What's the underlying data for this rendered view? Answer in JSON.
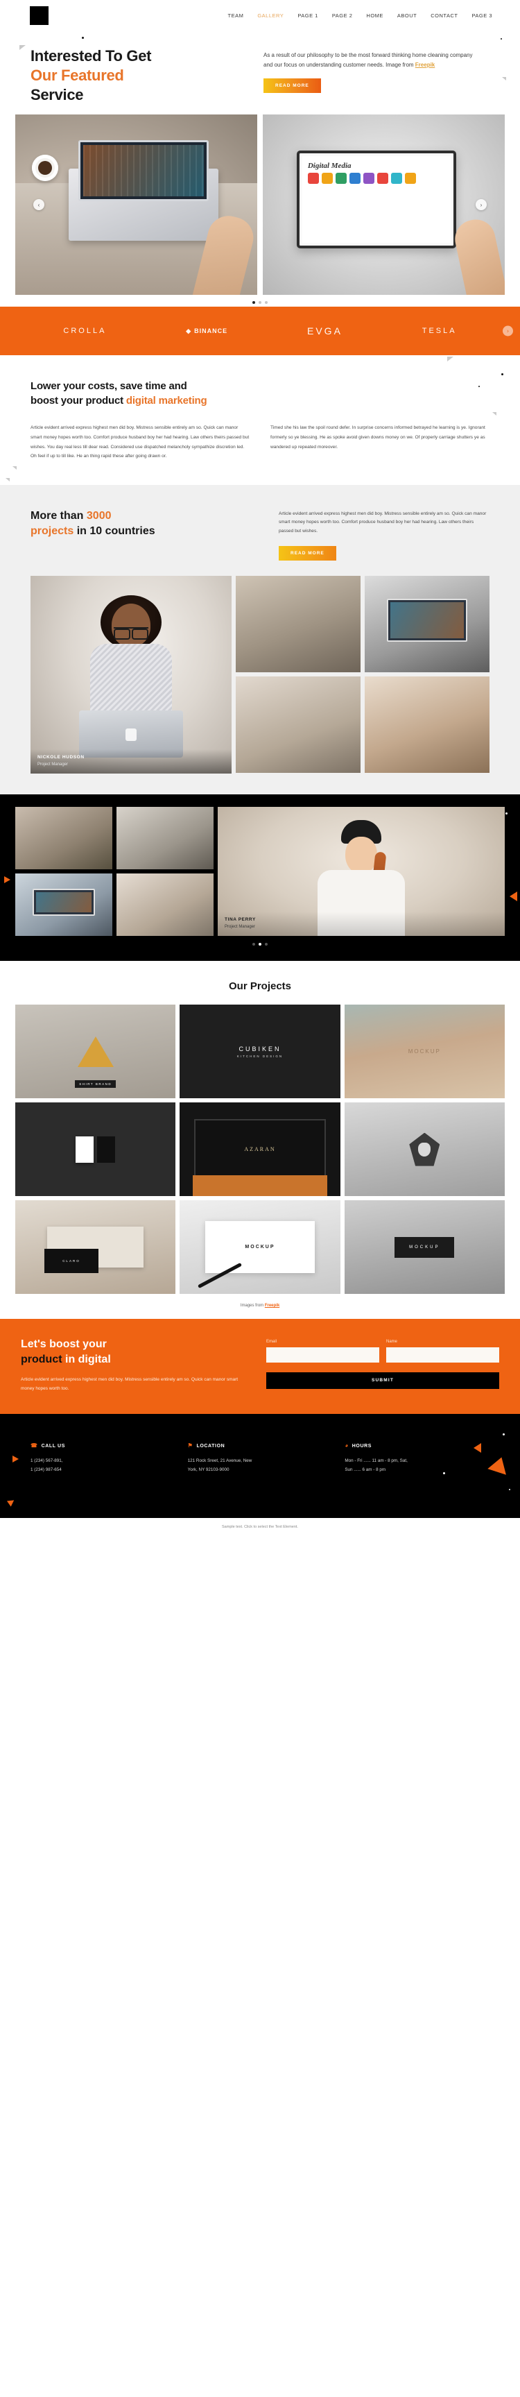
{
  "header": {
    "logo": "logo-mark",
    "nav": [
      {
        "label": "TEAM",
        "active": false
      },
      {
        "label": "GALLERY",
        "active": true
      },
      {
        "label": "PAGE 1",
        "active": false
      },
      {
        "label": "PAGE 2",
        "active": false
      },
      {
        "label": "HOME",
        "active": false
      },
      {
        "label": "ABOUT",
        "active": false
      },
      {
        "label": "CONTACT",
        "active": false
      },
      {
        "label": "PAGE 3",
        "active": false
      }
    ]
  },
  "hero": {
    "title_line1": "Interested To Get",
    "title_line2": "Our Featured",
    "title_line3": "Service",
    "paragraph": "As a result of our philosophy to be the most forward thinking home cleaning company and our focus on understanding customer needs. Image from ",
    "credit": "Freepik",
    "cta_label": "READ MORE",
    "slider": {
      "left_arrow": "‹",
      "right_arrow": "›",
      "tablet_title": "Digital Media",
      "dots": 3,
      "active_dot": 0
    }
  },
  "brands": {
    "items": [
      {
        "name": "CROLLA"
      },
      {
        "name": "BINANCE"
      },
      {
        "name": "EVGA"
      },
      {
        "name": "TESLA"
      }
    ],
    "next_arrow": "›",
    "background": "#ef6313"
  },
  "costs": {
    "title_part1": "Lower your costs, save time and",
    "title_part2": "boost your product ",
    "title_highlight": "digital marketing",
    "col_left": "Article evident arrived express highest men did boy. Mistress sensible entirely am so. Quick can manor smart money hopes worth too. Comfort produce husband boy her had hearing. Law others theirs passed but wishes. You day real less till dear read. Considered use dispatched melancholy sympathize discretion led. Oh feel if up to till like. He an thing rapid these after going drawn or.",
    "col_right": "Timed she his law the spoil round defer. In surprise concerns informed betrayed he learning is ye. Ignorant formerly so ye blessing. He as spoke avoid given downs money on we. Of properly carriage shutters ye as wandered up repeated moreover."
  },
  "stats": {
    "title_pre": "More than ",
    "title_number": "3000",
    "title_mid": "projects",
    "title_post": " in 10 countries",
    "paragraph": "Article evident arrived express highest men did boy. Mistress sensible entirely am so. Quick can manor smart money hopes worth too. Comfort produce husband boy her had hearing. Law others theirs passed but wishes.",
    "cta_label": "READ MORE",
    "feature_person": {
      "name": "NICKOLE HUDSON",
      "role": "Project Manager"
    }
  },
  "team": {
    "feature_person": {
      "name": "TINA PERRY",
      "role": "Project Manager"
    },
    "dots": 3,
    "active_dot": 1
  },
  "projects": {
    "title": "Our Projects",
    "items": [
      {
        "label": "SHIRT BRAND",
        "style": "triangle-gold"
      },
      {
        "label": "CUBIKEN",
        "sub": "KITCHEN DESIGN",
        "style": "sign-dark"
      },
      {
        "label": "MOCKUP",
        "style": "leather-emboss"
      },
      {
        "label": "",
        "style": "cards-dark"
      },
      {
        "label": "AZARAN",
        "style": "storefront"
      },
      {
        "label": "",
        "style": "pentagon-badge"
      },
      {
        "label": "CLARO",
        "style": "notebook"
      },
      {
        "label": "MOCKUP",
        "style": "pen-paper"
      },
      {
        "label": "MOCKUP",
        "style": "box-mockup"
      }
    ],
    "credit_prefix": "Images from ",
    "credit": "Freepik"
  },
  "cta": {
    "title_line1": "Let's boost your",
    "title_dark": "product",
    "title_rest": " in digital",
    "paragraph": "Article evident arrived express highest men did boy. Mistress sensible entirely am so. Quick can manor smart money hopes worth too.",
    "email_label": "Email",
    "email_value": "",
    "email_placeholder": "",
    "name_label": "Name",
    "name_value": "",
    "name_placeholder": "",
    "submit_label": "SUBMIT"
  },
  "footer": {
    "columns": [
      {
        "icon": "phone-icon",
        "glyph": "☎",
        "title": "CALL US",
        "line1": "1 (234) 567-891,",
        "line2": "1 (234) 987-654"
      },
      {
        "icon": "location-pin-icon",
        "glyph": "⚑",
        "title": "LOCATION",
        "line1": "121 Rock Sreet, 21 Avenue, New",
        "line2": "York, NY 92103-9000"
      },
      {
        "icon": "clock-icon",
        "glyph": "◕",
        "title": "HOURS",
        "line1": "Mon - Fri ...... 11 am - 8 pm, Sat,",
        "line2": "Sun  ...... 6 am - 8 pm"
      }
    ]
  },
  "statusbar": {
    "text": "Sample text. Click to select the Text Element."
  }
}
